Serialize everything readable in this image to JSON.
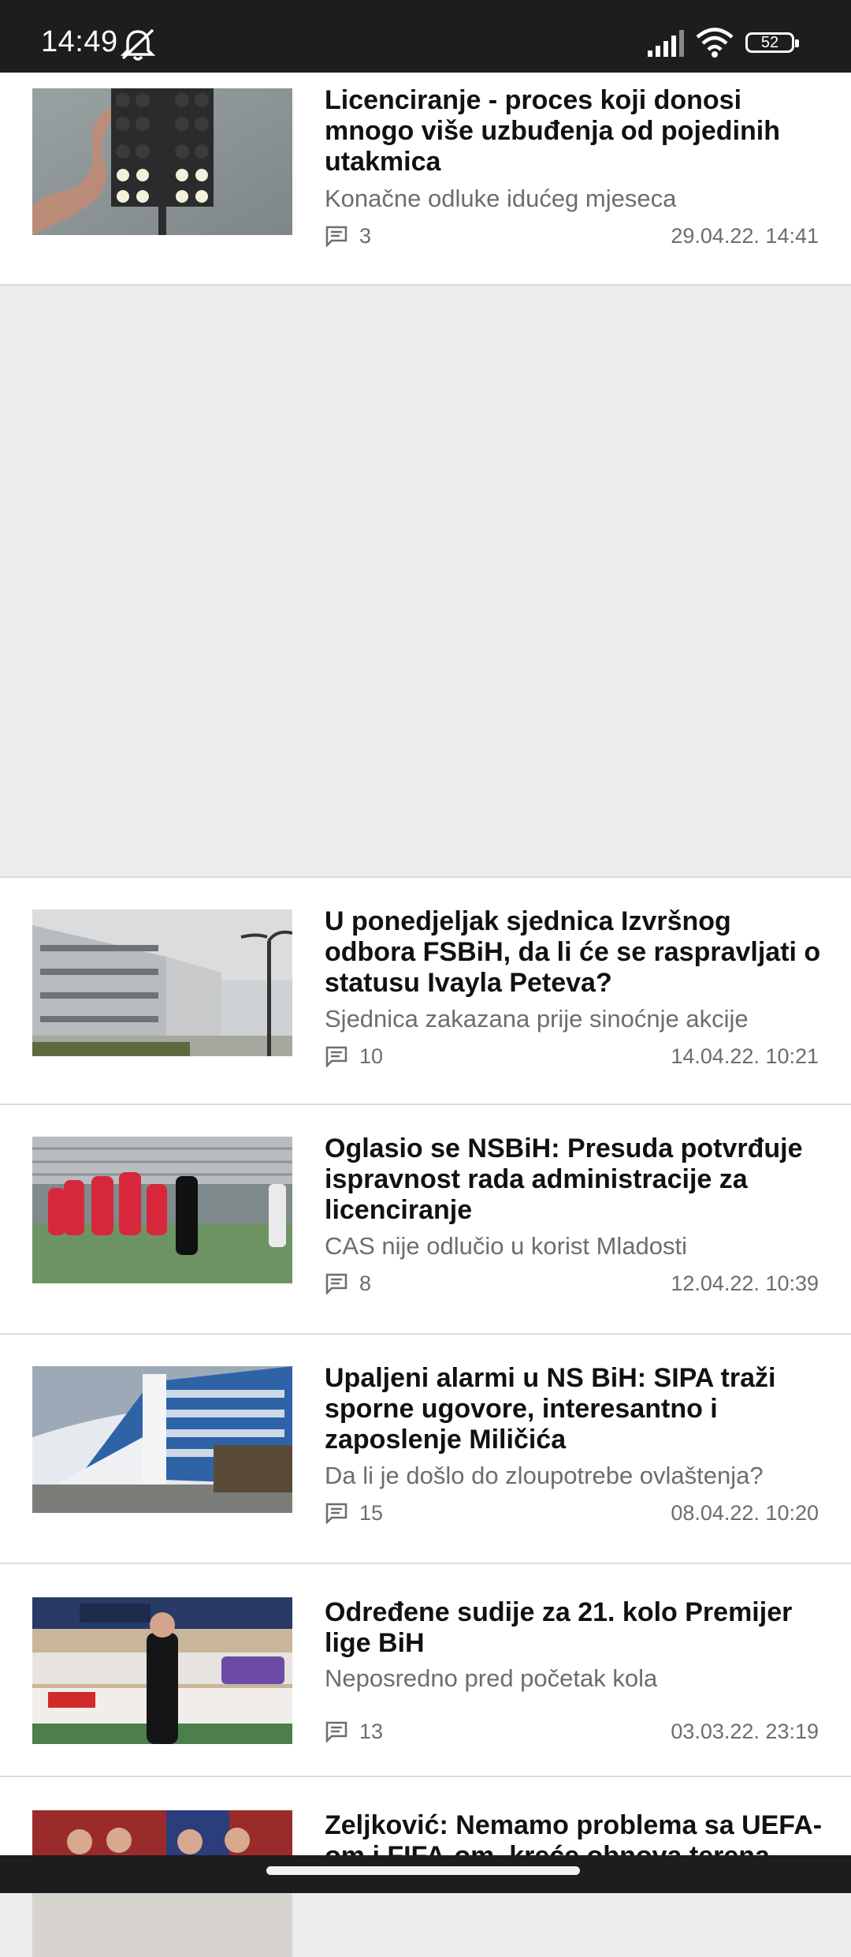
{
  "status_bar": {
    "time": "14:49",
    "battery": "52"
  },
  "articles": [
    {
      "title": "Licenciranje - proces koji donosi mnogo više uzbuđenja od pojedinih utakmica",
      "subtitle": "Konačne odluke idućeg mjeseca",
      "comments": "3",
      "date": "29.04.22. 14:41",
      "image": "floodlight-photo"
    },
    {
      "title": "U ponedjeljak sjednica Izvršnog odbora FSBiH, da li će se raspravljati o statusu Ivayla Peteva?",
      "subtitle": "Sjednica zakazana prije sinoćnje akcije",
      "comments": "10",
      "date": "14.04.22. 10:21",
      "image": "foggy-building-photo"
    },
    {
      "title": "Oglasio se NSBiH: Presuda potvrđuje ispravnost rada administracije za licenciranje",
      "subtitle": "CAS nije odlučio u korist Mladosti",
      "comments": "8",
      "date": "12.04.22. 10:39",
      "image": "football-players-photo"
    },
    {
      "title": "Upaljeni alarmi u NS BiH: SIPA traži sporne ugovore, interesantno i zaposlenje Miličića",
      "subtitle": "Da li je došlo do zloupotrebe ovlaštenja?",
      "comments": "15",
      "date": "08.04.22. 10:20",
      "image": "federation-building-photo"
    },
    {
      "title": "Određene sudije za 21. kolo Premijer lige BiH",
      "subtitle": "Neposredno pred početak kola",
      "comments": "13",
      "date": "03.03.22. 23:19",
      "image": "referee-photo"
    },
    {
      "title": "Zeljković: Nemamo problema sa UEFA-om i FIFA-om, kreće obnova terena",
      "subtitle": "",
      "comments": "",
      "date": "",
      "image": "press-conference-photo"
    }
  ],
  "colors": {
    "status_bar": "#1b1d1f",
    "page_bg": "#ececed",
    "card_bg": "#ffffff",
    "title": "#111111",
    "meta": "#6d6d6d"
  }
}
